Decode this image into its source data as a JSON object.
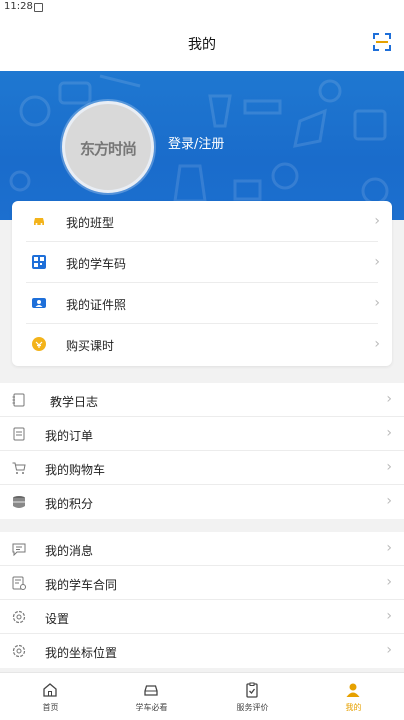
{
  "status_bar": {
    "time": "11:28"
  },
  "header": {
    "title": "我的"
  },
  "profile": {
    "avatar_text": "东方时尚",
    "login_text": "登录/注册"
  },
  "card_menu": [
    {
      "label": "我的班型",
      "icon": "car-icon"
    },
    {
      "label": "我的学车码",
      "icon": "qr-code-icon"
    },
    {
      "label": "我的证件照",
      "icon": "id-photo-icon"
    },
    {
      "label": "购买课时",
      "icon": "purchase-hours-icon"
    }
  ],
  "section1": [
    {
      "label": "教学日志",
      "icon": "notebook-icon"
    },
    {
      "label": "我的订单",
      "icon": "order-icon"
    },
    {
      "label": "我的购物车",
      "icon": "cart-icon"
    },
    {
      "label": "我的积分",
      "icon": "coins-icon"
    }
  ],
  "section2": [
    {
      "label": "我的消息",
      "icon": "message-icon"
    },
    {
      "label": "我的学车合同",
      "icon": "contract-icon"
    },
    {
      "label": "设置",
      "icon": "settings-icon"
    },
    {
      "label": "我的坐标位置",
      "icon": "location-icon"
    }
  ],
  "tabs": [
    {
      "label": "首页",
      "icon": "home-icon"
    },
    {
      "label": "学车必看",
      "icon": "car-outline-icon"
    },
    {
      "label": "服务评价",
      "icon": "clipboard-check-icon"
    },
    {
      "label": "我的",
      "icon": "user-icon",
      "active": true
    }
  ],
  "colors": {
    "accent": "#e6a100",
    "hero_blue": "#1a6ccb",
    "icon_blue": "#1e6fd9"
  }
}
